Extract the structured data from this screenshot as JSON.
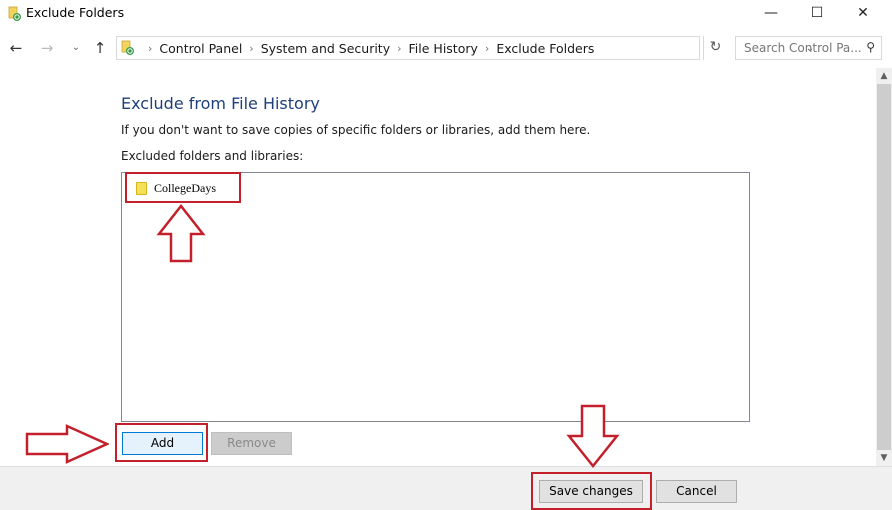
{
  "window": {
    "title": "Exclude Folders",
    "controls": {
      "minimize": "—",
      "maximize": "☐",
      "close": "✕"
    }
  },
  "nav": {
    "back_icon": "←",
    "forward_icon": "→",
    "recent_icon": "⌄",
    "up_icon": "↑",
    "breadcrumbs": [
      "Control Panel",
      "System and Security",
      "File History",
      "Exclude Folders"
    ],
    "separator": "›",
    "dropdown_icon": "⌄",
    "refresh_icon": "↻",
    "search_placeholder": "Search Control Pa...",
    "search_icon": "⚲"
  },
  "content": {
    "heading": "Exclude from File History",
    "description": "If you don't want to save copies of specific folders or libraries, add them here.",
    "list_label": "Excluded folders and libraries:",
    "excluded_items": [
      "CollegeDays"
    ],
    "add_label": "Add",
    "remove_label": "Remove"
  },
  "scrollbar": {
    "up_icon": "︿",
    "down_icon": "﹀"
  },
  "footer": {
    "save_label": "Save changes",
    "cancel_label": "Cancel"
  },
  "annotations": {
    "color": "#c4202b"
  }
}
